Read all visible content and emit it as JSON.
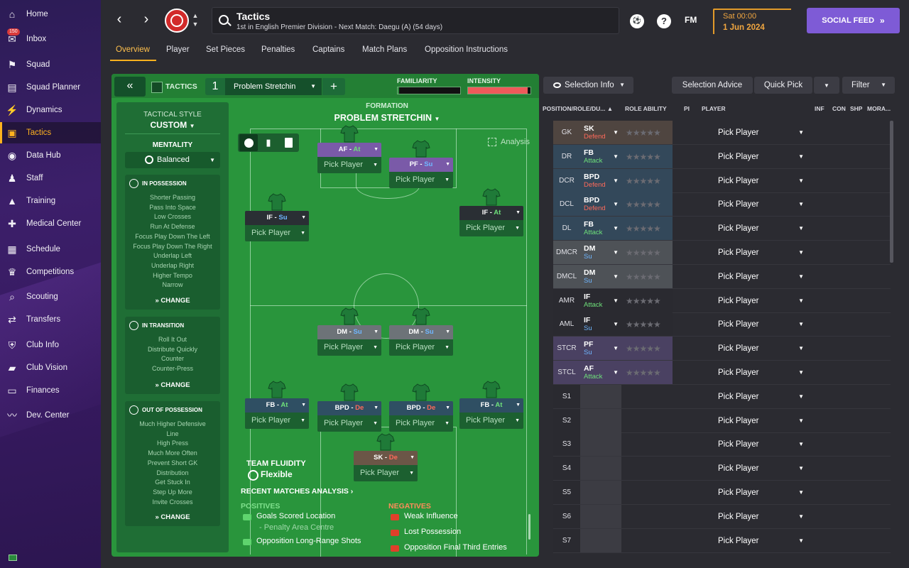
{
  "sidebar": {
    "items": [
      {
        "label": "Home",
        "icon": "home-icon"
      },
      {
        "label": "Inbox",
        "icon": "inbox-icon",
        "badge": "150"
      },
      {
        "label": "Squad",
        "icon": "squad-icon"
      },
      {
        "label": "Squad Planner",
        "icon": "clipboard-icon"
      },
      {
        "label": "Dynamics",
        "icon": "dynamics-icon"
      },
      {
        "label": "Tactics",
        "icon": "tactics-icon",
        "active": true
      },
      {
        "label": "Data Hub",
        "icon": "datahub-icon"
      },
      {
        "label": "Staff",
        "icon": "staff-icon"
      },
      {
        "label": "Training",
        "icon": "training-icon"
      },
      {
        "label": "Medical Center",
        "icon": "medical-icon"
      },
      {
        "label": "Schedule",
        "icon": "calendar-icon"
      },
      {
        "label": "Competitions",
        "icon": "trophy-icon"
      },
      {
        "label": "Scouting",
        "icon": "search-icon"
      },
      {
        "label": "Transfers",
        "icon": "transfers-icon"
      },
      {
        "label": "Club Info",
        "icon": "shield-icon"
      },
      {
        "label": "Club Vision",
        "icon": "briefcase-icon"
      },
      {
        "label": "Finances",
        "icon": "money-icon"
      },
      {
        "label": "Dev. Center",
        "icon": "devcenter-icon"
      }
    ]
  },
  "header": {
    "title": "Tactics",
    "subtitle": "1st in English Premier Division - Next Match: Daegu (A) (54 days)",
    "fm_logo": "FM",
    "help": "?",
    "date_day": "Sat 00:00",
    "date": "1 Jun 2024",
    "social_feed": "SOCIAL FEED",
    "accent": "#ffb21e",
    "social_color": "#7e5bd6"
  },
  "tabs": [
    "Overview",
    "Player",
    "Set Pieces",
    "Penalties",
    "Captains",
    "Match Plans",
    "Opposition Instructions"
  ],
  "panel": {
    "tactics_label": "TACTICS",
    "tactic_number": "1",
    "tactic_name": "Problem Stretchin",
    "familiarity_label": "FAMILIARITY",
    "familiarity_level": 0.02,
    "intensity_label": "INTENSITY",
    "intensity_level": 0.95,
    "tactical_style_label": "TACTICAL STYLE",
    "tactical_style": "CUSTOM",
    "mentality_label": "MENTALITY",
    "mentality": "Balanced",
    "in_possession": {
      "title": "IN POSSESSION",
      "items": [
        "Shorter Passing",
        "Pass Into Space",
        "Low Crosses",
        "Run At Defense",
        "Focus Play Down The Left",
        "Focus Play Down The Right",
        "Underlap Left",
        "Underlap Right",
        "Higher Tempo",
        "Narrow"
      ],
      "change": "CHANGE"
    },
    "in_transition": {
      "title": "IN TRANSITION",
      "items": [
        "Roll It Out",
        "Distribute Quickly",
        "Counter",
        "Counter-Press"
      ],
      "change": "CHANGE"
    },
    "out_of_possession": {
      "title": "OUT OF POSSESSION",
      "items": [
        "Much Higher Defensive",
        "Line",
        "High Press",
        "Much More Often",
        "Prevent Short GK",
        "Distribution",
        "Get Stuck In",
        "Step Up More",
        "Invite Crosses"
      ],
      "change": "CHANGE"
    },
    "formation_label": "FORMATION",
    "formation_name": "PROBLEM STRETCHIN",
    "analysis": "Analysis",
    "pick_player": "Pick Player",
    "players": [
      {
        "role": "AF",
        "duty": "At",
        "duty_class": "green-txt",
        "color": "purple"
      },
      {
        "role": "PF",
        "duty": "Su",
        "duty_class": "blue-txt",
        "color": "purple"
      },
      {
        "role": "IF",
        "duty": "Su",
        "duty_class": "blue-txt",
        "color": "dark"
      },
      {
        "role": "IF",
        "duty": "At",
        "duty_class": "green-txt",
        "color": "dark"
      },
      {
        "role": "DM",
        "duty": "Su",
        "duty_class": "blue-txt",
        "color": "grey"
      },
      {
        "role": "DM",
        "duty": "Su",
        "duty_class": "blue-txt",
        "color": "grey"
      },
      {
        "role": "FB",
        "duty": "At",
        "duty_class": "green-txt",
        "color": "blue"
      },
      {
        "role": "BPD",
        "duty": "De",
        "duty_class": "red-txt",
        "color": "blue"
      },
      {
        "role": "BPD",
        "duty": "De",
        "duty_class": "red-txt",
        "color": "blue"
      },
      {
        "role": "FB",
        "duty": "At",
        "duty_class": "green-txt",
        "color": "blue"
      },
      {
        "role": "SK",
        "duty": "De",
        "duty_class": "red-txt",
        "color": "brown"
      }
    ],
    "team_fluidity_label": "TEAM FLUIDITY",
    "team_fluidity": "Flexible",
    "recent_matches": "RECENT MATCHES ANALYSIS",
    "positives_label": "POSITIVES",
    "negatives_label": "NEGATIVES",
    "positives": [
      "Goals Scored Location",
      "- Penalty Area Centre",
      "Opposition Long-Range Shots"
    ],
    "negatives": [
      "Weak Influence",
      "Lost Possession",
      "Opposition Final Third Entries"
    ]
  },
  "selection": {
    "selection_info": "Selection Info",
    "selection_advice": "Selection Advice",
    "quick_pick": "Quick Pick",
    "filter": "Filter",
    "columns": {
      "position": "POSITION/ROLE/DU...",
      "role_ability": "ROLE ABILITY",
      "pi": "PI",
      "player": "PLAYER",
      "inf": "INF",
      "con": "CON",
      "shp": "SHP",
      "mora": "MORA..."
    },
    "rows": [
      {
        "pos": "GK",
        "role": "SK",
        "duty": "Defend",
        "duty_color": "#ff6a5a",
        "bg": "#4f4540"
      },
      {
        "pos": "DR",
        "role": "FB",
        "duty": "Attack",
        "duty_color": "#6ee07a",
        "bg": "#33485a"
      },
      {
        "pos": "DCR",
        "role": "BPD",
        "duty": "Defend",
        "duty_color": "#ff6a5a",
        "bg": "#33485a"
      },
      {
        "pos": "DCL",
        "role": "BPD",
        "duty": "Defend",
        "duty_color": "#ff6a5a",
        "bg": "#33485a"
      },
      {
        "pos": "DL",
        "role": "FB",
        "duty": "Attack",
        "duty_color": "#6ee07a",
        "bg": "#33485a"
      },
      {
        "pos": "DMCR",
        "role": "DM",
        "duty": "Su",
        "duty_color": "#6fb6ff",
        "bg": "#4e5257"
      },
      {
        "pos": "DMCL",
        "role": "DM",
        "duty": "Su",
        "duty_color": "#6fb6ff",
        "bg": "#4e5257"
      },
      {
        "pos": "AMR",
        "role": "IF",
        "duty": "Attack",
        "duty_color": "#6ee07a",
        "bg": "#2a2a30"
      },
      {
        "pos": "AML",
        "role": "IF",
        "duty": "Su",
        "duty_color": "#6fb6ff",
        "bg": "#2a2a30"
      },
      {
        "pos": "STCR",
        "role": "PF",
        "duty": "Su",
        "duty_color": "#6fb6ff",
        "bg": "#4a4162"
      },
      {
        "pos": "STCL",
        "role": "AF",
        "duty": "Attack",
        "duty_color": "#6ee07a",
        "bg": "#4a4162"
      },
      {
        "pos": "S1"
      },
      {
        "pos": "S2"
      },
      {
        "pos": "S3"
      },
      {
        "pos": "S4"
      },
      {
        "pos": "S5"
      },
      {
        "pos": "S6"
      },
      {
        "pos": "S7"
      }
    ]
  }
}
